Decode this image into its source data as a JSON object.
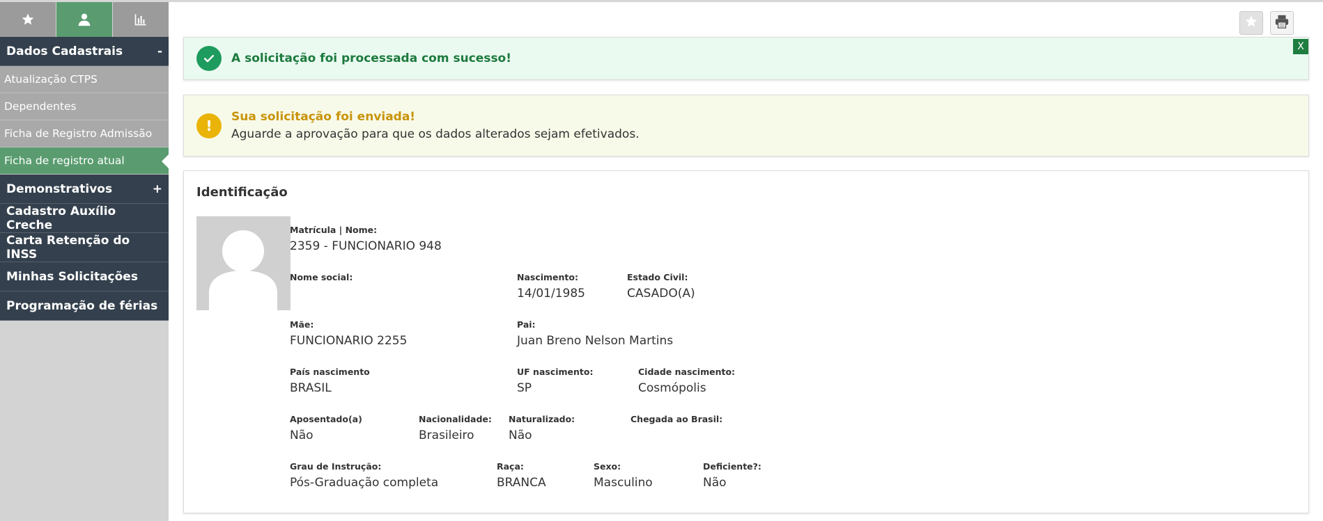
{
  "sidebar": {
    "tabs": [
      {
        "icon": "star-icon"
      },
      {
        "icon": "user-icon"
      },
      {
        "icon": "bar-chart-icon"
      }
    ],
    "menu": {
      "dados": {
        "label": "Dados Cadastrais",
        "toggle": "-"
      },
      "sub": {
        "ctps": "Atualização CTPS",
        "dependentes": "Dependentes",
        "ficha_admissao": "Ficha de Registro Admissão",
        "ficha_atual": "Ficha de registro atual"
      },
      "demonstrativos": {
        "label": "Demonstrativos",
        "toggle": "+"
      },
      "creche": "Cadastro Auxílio Creche",
      "inss": "Carta Retenção do INSS",
      "solicitacoes": "Minhas Solicitações",
      "ferias": "Programação de férias"
    }
  },
  "toolbar": {
    "star_icon": "star-icon",
    "print_icon": "printer-icon"
  },
  "alerts": {
    "success": {
      "message": "A solicitação foi processada com sucesso!",
      "close": "X",
      "color": "#1e9b5e"
    },
    "warning": {
      "title": "Sua solicitação foi enviada!",
      "body": "Aguarde a aprovação para que os dados alterados sejam efetivados.",
      "color": "#eab308"
    }
  },
  "identificacao": {
    "title": "Identificação",
    "matricula": {
      "label": "Matrícula | Nome:",
      "value": "2359 - FUNCIONARIO 948"
    },
    "nome_social": {
      "label": "Nome social:",
      "value": ""
    },
    "nascimento": {
      "label": "Nascimento:",
      "value": "14/01/1985"
    },
    "estado_civil": {
      "label": "Estado Civil:",
      "value": "CASADO(A)"
    },
    "mae": {
      "label": "Mãe:",
      "value": "FUNCIONARIO 2255"
    },
    "pai": {
      "label": "Pai:",
      "value": "Juan Breno Nelson Martins"
    },
    "pais_nascimento": {
      "label": "País nascimento",
      "value": "BRASIL"
    },
    "uf_nascimento": {
      "label": "UF nascimento:",
      "value": "SP"
    },
    "cidade_nascimento": {
      "label": "Cidade nascimento:",
      "value": "Cosmópolis"
    },
    "aposentado": {
      "label": "Aposentado(a)",
      "value": "Não"
    },
    "nacionalidade": {
      "label": "Nacionalidade:",
      "value": "Brasileiro"
    },
    "naturalizado": {
      "label": "Naturalizado:",
      "value": "Não"
    },
    "chegada": {
      "label": "Chegada ao Brasil:",
      "value": ""
    },
    "grau_instrucao": {
      "label": "Grau de Instrução:",
      "value": "Pós-Graduação completa"
    },
    "raca": {
      "label": "Raça:",
      "value": "BRANCA"
    },
    "sexo": {
      "label": "Sexo:",
      "value": "Masculino"
    },
    "deficiente": {
      "label": "Deficiente?:",
      "value": "Não"
    }
  },
  "colors": {
    "sidebar_dark": "#34404d",
    "active_green": "#5a9c6f",
    "sub_gray": "#a9a9a9"
  }
}
